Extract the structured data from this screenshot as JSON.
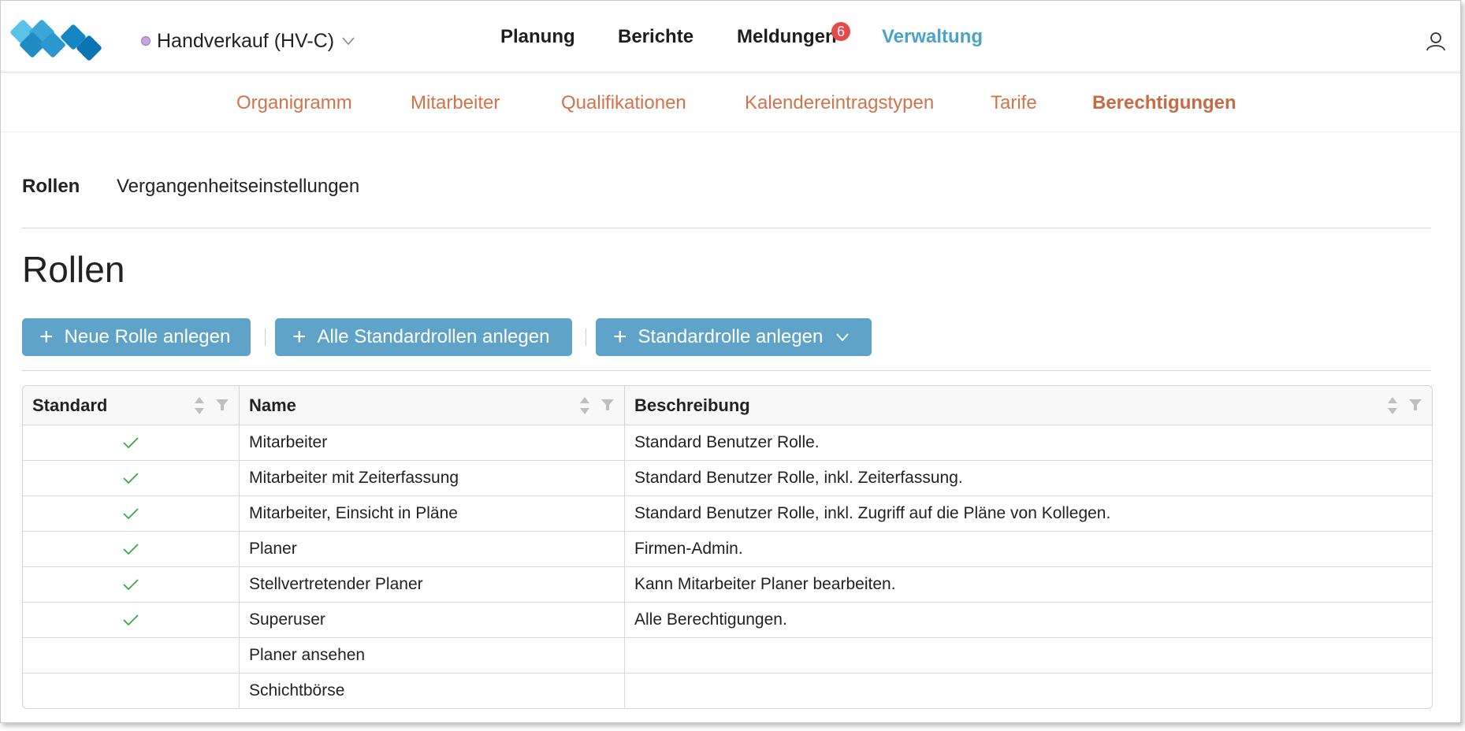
{
  "header": {
    "company": "Handverkauf (HV-C)",
    "nav": [
      {
        "label": "Planung"
      },
      {
        "label": "Berichte"
      },
      {
        "label": "Meldungen"
      },
      {
        "label": "Verwaltung"
      }
    ],
    "notification_count": "6",
    "accent_color": "#4aa3c9"
  },
  "subnav": {
    "items": [
      {
        "label": "Organigramm"
      },
      {
        "label": "Mitarbeiter"
      },
      {
        "label": "Qualifikationen"
      },
      {
        "label": "Kalendereintragstypen"
      },
      {
        "label": "Tarife"
      },
      {
        "label": "Berechtigungen"
      }
    ],
    "color": "#d2734a"
  },
  "tabs": {
    "items": [
      {
        "label": "Rollen"
      },
      {
        "label": "Vergangenheitseinstellungen"
      }
    ]
  },
  "page": {
    "title": "Rollen"
  },
  "toolbar": {
    "new_role": "Neue Rolle anlegen",
    "all_default_roles": "Alle Standardrollen anlegen",
    "default_role": "Standardrolle anlegen",
    "button_color": "#5fa3c8"
  },
  "table": {
    "headers": {
      "standard": "Standard",
      "name": "Name",
      "description": "Beschreibung"
    },
    "rows": [
      {
        "standard": true,
        "name": "Mitarbeiter",
        "description": "Standard Benutzer Rolle."
      },
      {
        "standard": true,
        "name": "Mitarbeiter mit Zeiterfassung",
        "description": "Standard Benutzer Rolle, inkl. Zeiterfassung."
      },
      {
        "standard": true,
        "name": "Mitarbeiter, Einsicht in Pläne",
        "description": "Standard Benutzer Rolle, inkl. Zugriff auf die Pläne von Kollegen."
      },
      {
        "standard": true,
        "name": "Planer",
        "description": "Firmen-Admin."
      },
      {
        "standard": true,
        "name": "Stellvertretender Planer",
        "description": "Kann Mitarbeiter Planer bearbeiten."
      },
      {
        "standard": true,
        "name": "Superuser",
        "description": "Alle Berechtigungen."
      },
      {
        "standard": false,
        "name": "Planer ansehen",
        "description": ""
      },
      {
        "standard": false,
        "name": "Schichtbörse",
        "description": ""
      }
    ],
    "check_color": "#3aa845"
  }
}
